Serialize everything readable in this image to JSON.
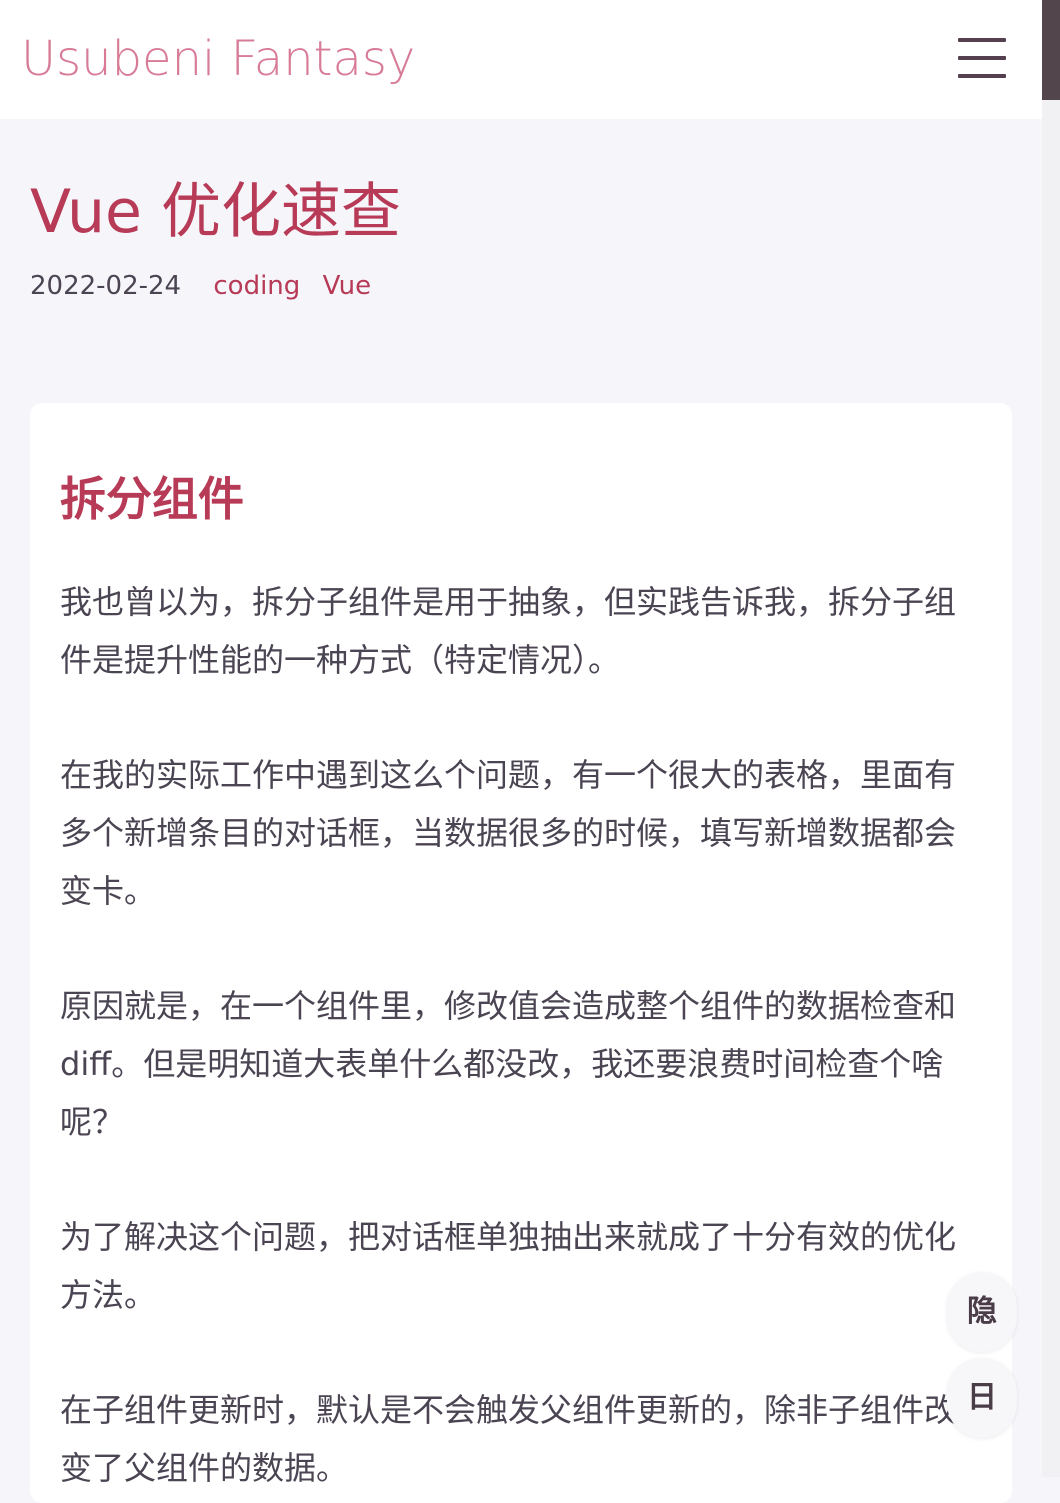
{
  "header": {
    "site_title": "Usubeni Fantasy",
    "menu_icon": "hamburger-menu-icon"
  },
  "post": {
    "title": "Vue 优化速查",
    "date": "2022-02-24",
    "tags": [
      "coding",
      "Vue"
    ]
  },
  "content": {
    "heading": "拆分组件",
    "paragraphs": [
      [
        "我也曾以为，拆分子组件是用于抽象，但实践告诉我，拆分子组",
        "件是提升性能的一种方式（特定情况）。"
      ],
      [
        "在我的实际工作中遇到这么个问题，有一个很大的表格，里面有",
        "多个新增条目的对话框，当数据很多的时候，填写新增数据都会",
        "变卡。"
      ],
      [
        "原因就是，在一个组件里，修改值会造成整个组件的数据检查和",
        "diff。但是明知道大表单什么都没改，我还要浪费时间检查个啥",
        "呢？"
      ],
      [
        "为了解决这个问题，把对话框单独抽出来就成了十分有效的优化",
        "方法。"
      ],
      [
        "在子组件更新时，默认是不会触发父组件更新的，除非子组件改",
        "变了父组件的数据。"
      ]
    ]
  },
  "floating_buttons": {
    "hide_label": "隐",
    "theme_label": "日"
  },
  "colors": {
    "accent": "#b73a57",
    "site_title": "#d77b97",
    "text": "#4b4452",
    "page_bg": "#f6f6fa"
  }
}
